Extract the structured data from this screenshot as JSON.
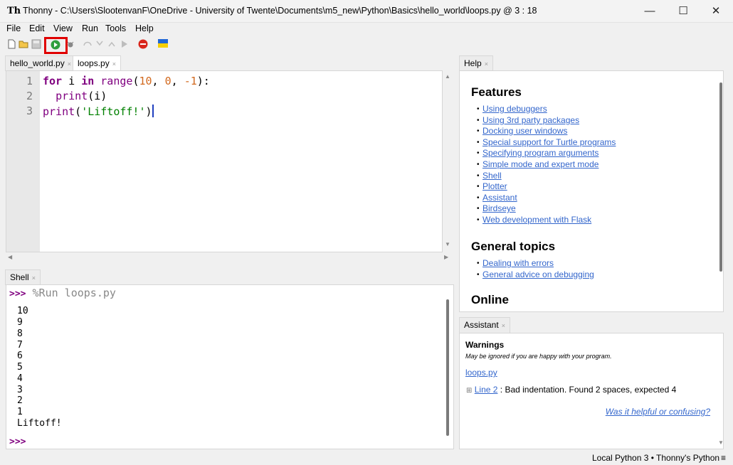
{
  "window": {
    "app_icon": "Th",
    "title": "Thonny  -  C:\\Users\\SlootenvanF\\OneDrive - University of Twente\\Documents\\m5_new\\Python\\Basics\\hello_world\\loops.py  @  3 : 18",
    "minimize": "—",
    "maximize": "☐",
    "close": "✕"
  },
  "menu": [
    "File",
    "Edit",
    "View",
    "Run",
    "Tools",
    "Help"
  ],
  "toolbar": {
    "icons": [
      "new-file-icon",
      "open-file-icon",
      "save-icon",
      "run-icon",
      "debug-icon",
      "step-over-icon",
      "step-into-icon",
      "step-out-icon",
      "resume-icon",
      "stop-icon",
      "ukraine-flag-icon"
    ],
    "highlight_color": "#e00000"
  },
  "editor": {
    "tabs": [
      {
        "label": "hello_world.py",
        "close": "×"
      },
      {
        "label": "loops.py",
        "close": "×"
      }
    ],
    "line_numbers": [
      "1",
      "2",
      "3"
    ],
    "lines": [
      {
        "kw1": "for",
        "t1": " i ",
        "kw2": "in",
        "t2": " ",
        "fn": "range",
        "t3": "(",
        "n1": "10",
        "t4": ", ",
        "n2": "0",
        "t5": ", ",
        "n3": "-1",
        "t6": "):"
      },
      {
        "indent": "  ",
        "fn": "print",
        "rest": "(i)"
      },
      {
        "fn": "print",
        "t1": "(",
        "str": "'Liftoff!'",
        "t2": ")"
      }
    ]
  },
  "shell": {
    "tab_label": "Shell",
    "tab_close": "×",
    "prompt": ">>>",
    "run_command": " %Run loops.py",
    "output": [
      "10",
      "9",
      "8",
      "7",
      "6",
      "5",
      "4",
      "3",
      "2",
      "1",
      "Liftoff!"
    ],
    "final_prompt": ">>>"
  },
  "help": {
    "tab_label": "Help",
    "tab_close": "×",
    "sections": [
      {
        "heading": "Features",
        "links": [
          "Using debuggers",
          "Using 3rd party packages",
          "Docking user windows",
          "Special support for Turtle programs",
          "Specifying program arguments",
          "Simple mode and expert mode",
          "Shell",
          "Plotter",
          "Assistant",
          "Birdseye",
          "Web development with Flask"
        ]
      },
      {
        "heading": "General topics",
        "links": [
          "Dealing with errors",
          "General advice on debugging"
        ]
      },
      {
        "heading": "Online",
        "links": []
      }
    ]
  },
  "assistant": {
    "tab_label": "Assistant",
    "tab_close": "×",
    "warnings_title": "Warnings",
    "warnings_sub": "May be ignored if you are happy with your program.",
    "file_link": "loops.py",
    "expand": "⊞",
    "line_link": "Line 2",
    "message": " : Bad indentation. Found 2 spaces, expected 4",
    "feedback_link": "Was it helpful or confusing?"
  },
  "status": {
    "interpreter": "Local Python 3  •  Thonny's Python",
    "menu_icon": "≡"
  }
}
